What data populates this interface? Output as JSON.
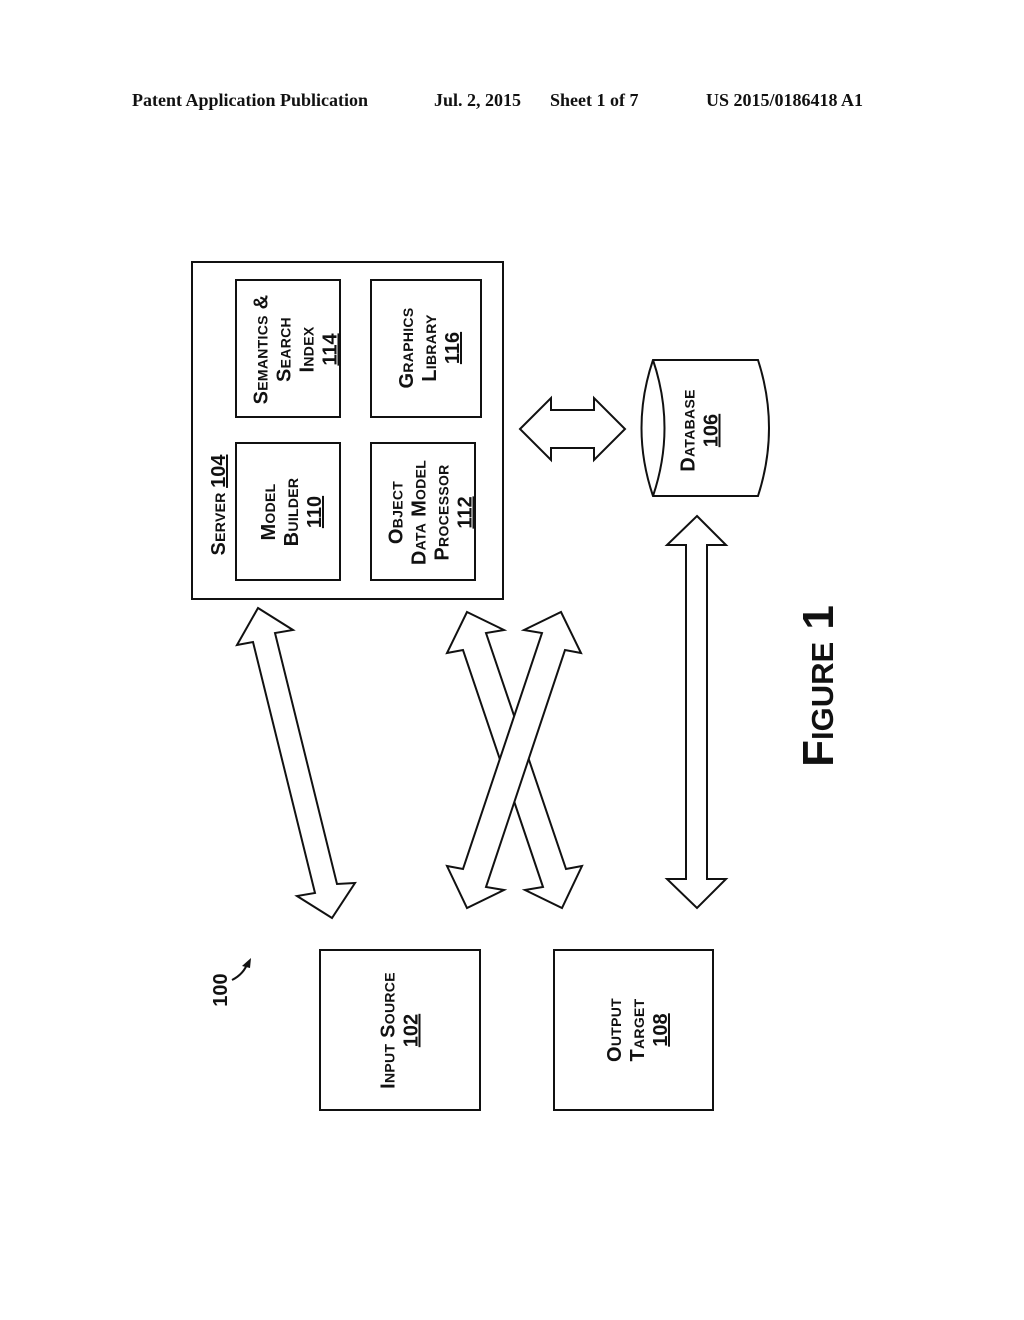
{
  "header": {
    "publication": "Patent Application Publication",
    "date": "Jul. 2, 2015",
    "sheet": "Sheet 1 of 7",
    "number": "US 2015/0186418 A1"
  },
  "figure": {
    "label": "Figure 1",
    "system_ref": "100"
  },
  "server": {
    "label": "Server",
    "ref": "104"
  },
  "modules": {
    "model_builder": {
      "line1": "Model",
      "line2": "Builder",
      "ref": "110"
    },
    "object_data_model_processor": {
      "line1": "Object",
      "line2": "Data Model",
      "line3": "Processor",
      "ref": "112"
    },
    "semantics_search_index": {
      "line1": "Semantics &",
      "line2": "Search",
      "line3": "Index",
      "ref": "114"
    },
    "graphics_library": {
      "line1": "Graphics",
      "line2": "Library",
      "ref": "116"
    }
  },
  "database": {
    "label": "Database",
    "ref": "106"
  },
  "input_source": {
    "label": "Input Source",
    "ref": "102"
  },
  "output_target": {
    "line1": "Output",
    "line2": "Target",
    "ref": "108"
  }
}
